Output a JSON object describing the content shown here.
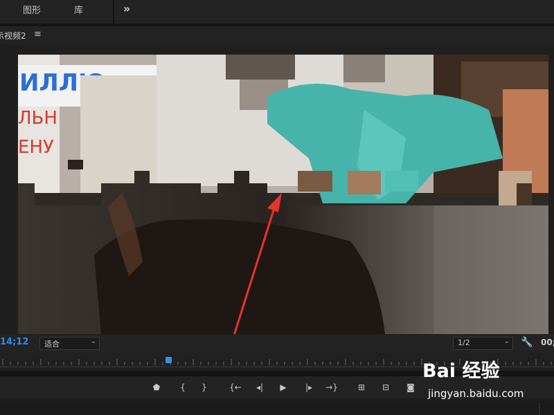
{
  "top_tabs": [
    "图形",
    "库"
  ],
  "top_more_icon": "double-chevron-right-icon",
  "panel": {
    "title": "示视频2",
    "menu_icon": "hamburger-menu-icon"
  },
  "controls": {
    "timecode": "14;12",
    "fit_label": "适合",
    "resolution_label": "1/2",
    "settings_icon": "wrench-icon",
    "timecode_right": "00;"
  },
  "transport": {
    "buttons": [
      "add-marker",
      "mark-in",
      "mark-out",
      "go-to-in",
      "step-back",
      "play",
      "step-forward",
      "go-to-out",
      "insert",
      "overwrite",
      "export-frame"
    ]
  },
  "watermark": {
    "brand": "Bai 经验",
    "url": "jingyan.baidu.com"
  },
  "colors": {
    "timecode": "#2d8ceb",
    "arrow": "#e8322c",
    "playhead": "#3a8fe8"
  }
}
